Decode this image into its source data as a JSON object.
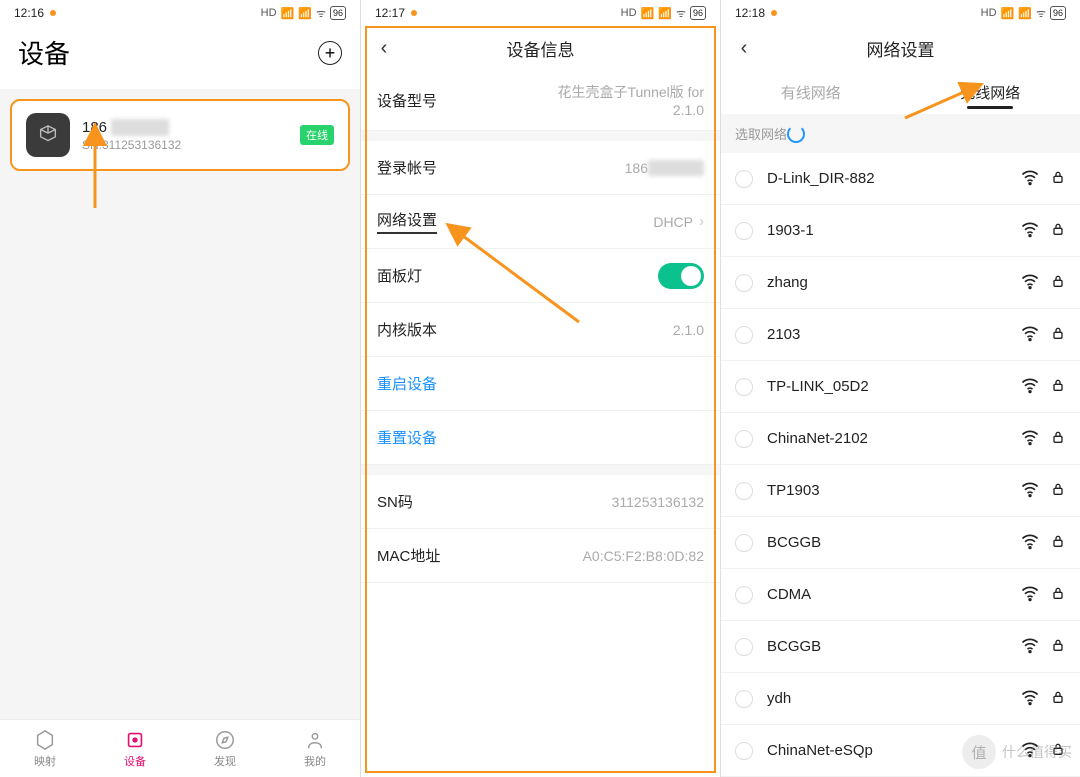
{
  "status": {
    "t1": "12:16",
    "t2": "12:17",
    "t3": "12:18",
    "batt": "96"
  },
  "phone1": {
    "title": "设备",
    "device": {
      "name_prefix": "186",
      "sn_label": "SN:311253136132",
      "badge": "在线"
    },
    "tabs": [
      "映射",
      "设备",
      "发现",
      "我的"
    ]
  },
  "phone2": {
    "title": "设备信息",
    "rows": {
      "model_lbl": "设备型号",
      "model_val": "花生壳盒子Tunnel版 for 2.1.0",
      "login_lbl": "登录帐号",
      "login_val": "186",
      "net_lbl": "网络设置",
      "net_val": "DHCP",
      "panel_lbl": "面板灯",
      "kernel_lbl": "内核版本",
      "kernel_val": "2.1.0",
      "reboot": "重启设备",
      "reset": "重置设备",
      "sn_lbl": "SN码",
      "sn_val": "311253136132",
      "mac_lbl": "MAC地址",
      "mac_val": "A0:C5:F2:B8:0D:82"
    }
  },
  "phone3": {
    "title": "网络设置",
    "tab_wired": "有线网络",
    "tab_wireless": "无线网络",
    "select_label": "选取网络",
    "networks": [
      "D-Link_DIR-882",
      "1903-1",
      "zhang",
      "2103",
      "TP-LINK_05D2",
      "ChinaNet-2102",
      "TP1903",
      "BCGGB",
      "CDMA",
      "BCGGB",
      "ydh",
      "ChinaNet-eSQp"
    ]
  },
  "watermark": "什么值得买"
}
